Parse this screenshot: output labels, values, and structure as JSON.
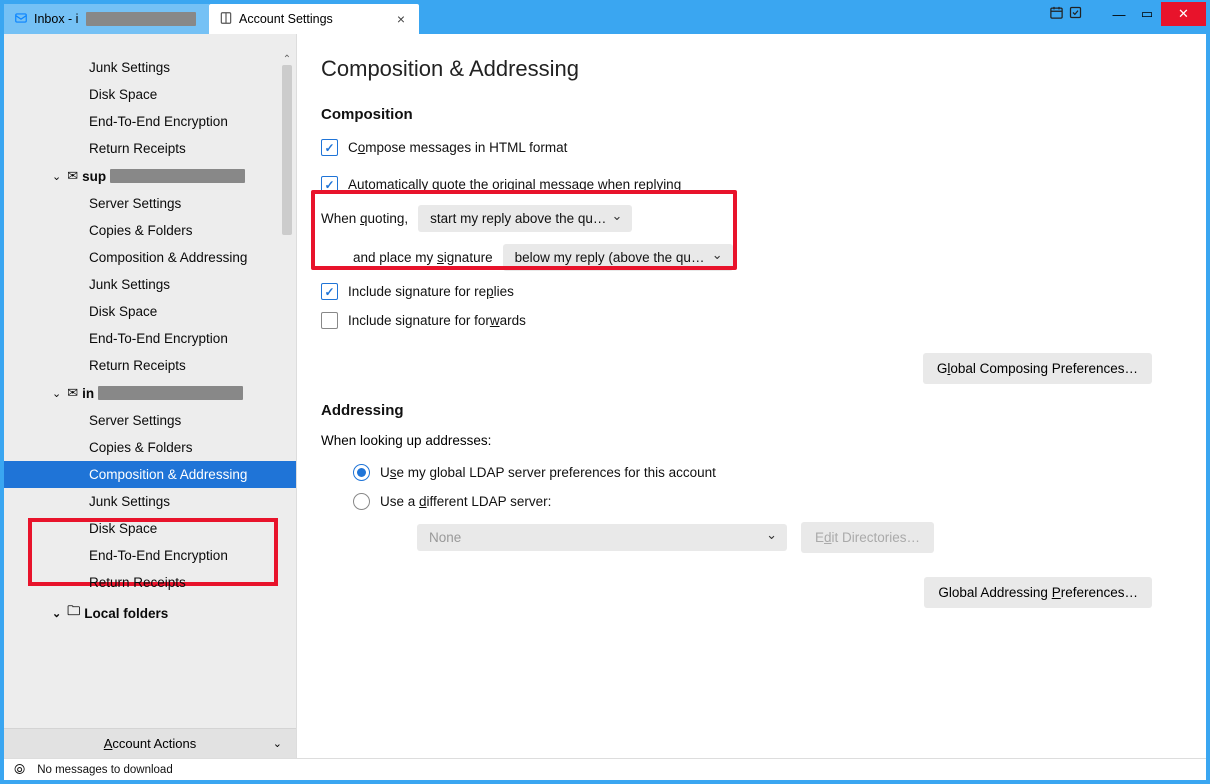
{
  "tabs": {
    "inactive_prefix": "Inbox - i",
    "active": "Account Settings"
  },
  "sidebar": {
    "group1": [
      "Junk Settings",
      "Disk Space",
      "End-To-End Encryption",
      "Return Receipts"
    ],
    "acct2_prefix": "sup",
    "group2": [
      "Server Settings",
      "Copies & Folders",
      "Composition & Addressing",
      "Junk Settings",
      "Disk Space",
      "End-To-End Encryption",
      "Return Receipts"
    ],
    "acct3_prefix": "in",
    "group3": [
      "Server Settings",
      "Copies & Folders",
      "Composition & Addressing",
      "Junk Settings",
      "Disk Space",
      "End-To-End Encryption",
      "Return Receipts"
    ],
    "local": "Local folders",
    "actions": "Account Actions"
  },
  "main": {
    "title": "Composition & Addressing",
    "sec_comp": "Composition",
    "compose_html_pre": "C",
    "compose_html_u": "o",
    "compose_html_post": "mpose messages in HTML format",
    "auto_quote_pre": "Auto",
    "auto_quote_u": "m",
    "auto_quote_post": "atically quote the original message when replying",
    "when_quoting_pre": "When ",
    "when_quoting_u": "q",
    "when_quoting_post": "uoting,",
    "quote_select": "start my reply above the qu…",
    "place_sig_pre": "and place my ",
    "place_sig_u": "s",
    "place_sig_post": "ignature",
    "sig_select": "below my reply (above the qu…",
    "incl_sig_reply_pre": "Include signature for re",
    "incl_sig_reply_u": "p",
    "incl_sig_reply_post": "lies",
    "incl_sig_fwd_pre": "Include signature for for",
    "incl_sig_fwd_u": "w",
    "incl_sig_fwd_post": "ards",
    "global_comp_pre": "G",
    "global_comp_u": "l",
    "global_comp_post": "obal Composing Preferences…",
    "sec_addr": "Addressing",
    "lookup": "When looking up addresses:",
    "ldap1_pre": "U",
    "ldap1_u": "s",
    "ldap1_post": "e my global LDAP server preferences for this account",
    "ldap2_pre": "Use a ",
    "ldap2_u": "d",
    "ldap2_post": "ifferent LDAP server:",
    "none": "None",
    "edit_dir_pre": "E",
    "edit_dir_u": "d",
    "edit_dir_post": "it Directories…",
    "global_addr_pre": "Global Addressing ",
    "global_addr_u": "P",
    "global_addr_post": "references…"
  },
  "status": "No messages to download"
}
